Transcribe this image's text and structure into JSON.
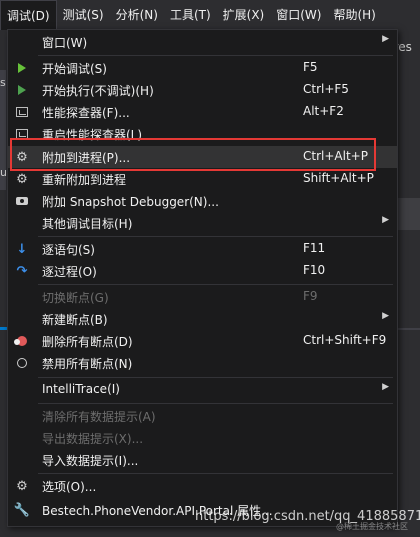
{
  "menubar": {
    "items": [
      "调试(D)",
      "测试(S)",
      "分析(N)",
      "工具(T)",
      "扩展(X)",
      "窗口(W)",
      "帮助(H)"
    ]
  },
  "background": {
    "tab_text": "pres",
    "side_text": "s",
    "side_text2": "u"
  },
  "menu": {
    "items": [
      {
        "label": "窗口(W)",
        "shortcut": "",
        "submenu": true,
        "icon": "none",
        "disabled": false
      },
      {
        "label": "开始调试(S)",
        "shortcut": "F5",
        "submenu": false,
        "icon": "play-icon",
        "disabled": false
      },
      {
        "label": "开始执行(不调试)(H)",
        "shortcut": "Ctrl+F5",
        "submenu": false,
        "icon": "play-outline-icon",
        "disabled": false
      },
      {
        "label": "性能探查器(F)...",
        "shortcut": "Alt+F2",
        "submenu": false,
        "icon": "profiler-icon",
        "disabled": false
      },
      {
        "label": "重启性能探查器(L)",
        "shortcut": "",
        "submenu": false,
        "icon": "profiler-restart-icon",
        "disabled": false
      },
      {
        "label": "附加到进程(P)...",
        "shortcut": "Ctrl+Alt+P",
        "submenu": false,
        "icon": "attach-gear-icon",
        "disabled": false,
        "highlighted": true
      },
      {
        "label": "重新附加到进程",
        "shortcut": "Shift+Alt+P",
        "submenu": false,
        "icon": "reattach-gear-icon",
        "disabled": false
      },
      {
        "label": "附加 Snapshot Debugger(N)...",
        "shortcut": "",
        "submenu": false,
        "icon": "camera-icon",
        "disabled": false
      },
      {
        "label": "其他调试目标(H)",
        "shortcut": "",
        "submenu": true,
        "icon": "none",
        "disabled": false
      },
      {
        "label": "逐语句(S)",
        "shortcut": "F11",
        "submenu": false,
        "icon": "step-into-icon",
        "disabled": false
      },
      {
        "label": "逐过程(O)",
        "shortcut": "F10",
        "submenu": false,
        "icon": "step-over-icon",
        "disabled": false
      },
      {
        "label": "切换断点(G)",
        "shortcut": "F9",
        "submenu": false,
        "icon": "none",
        "disabled": true
      },
      {
        "label": "新建断点(B)",
        "shortcut": "",
        "submenu": true,
        "icon": "none",
        "disabled": false
      },
      {
        "label": "删除所有断点(D)",
        "shortcut": "Ctrl+Shift+F9",
        "submenu": false,
        "icon": "delete-breakpoints-icon",
        "disabled": false
      },
      {
        "label": "禁用所有断点(N)",
        "shortcut": "",
        "submenu": false,
        "icon": "disable-breakpoints-icon",
        "disabled": false
      },
      {
        "label": "IntelliTrace(I)",
        "shortcut": "",
        "submenu": true,
        "icon": "none",
        "disabled": false
      },
      {
        "label": "清除所有数据提示(A)",
        "shortcut": "",
        "submenu": false,
        "icon": "none",
        "disabled": true
      },
      {
        "label": "导出数据提示(X)...",
        "shortcut": "",
        "submenu": false,
        "icon": "none",
        "disabled": true
      },
      {
        "label": "导入数据提示(I)...",
        "shortcut": "",
        "submenu": false,
        "icon": "none",
        "disabled": false
      },
      {
        "label": "选项(O)...",
        "shortcut": "",
        "submenu": false,
        "icon": "gear-icon",
        "disabled": false
      },
      {
        "label": "Bestech.PhoneVendor.API.Portal 属性...",
        "shortcut": "",
        "submenu": false,
        "icon": "wrench-icon",
        "disabled": false
      }
    ]
  },
  "watermark": {
    "text": "https://blog.csdn.net/qq_41885871",
    "small": "@稀土掘金技术社区"
  },
  "colors": {
    "menu_bg": "#1b1b1c",
    "highlight_border": "#e53935",
    "accent": "#007acc"
  }
}
